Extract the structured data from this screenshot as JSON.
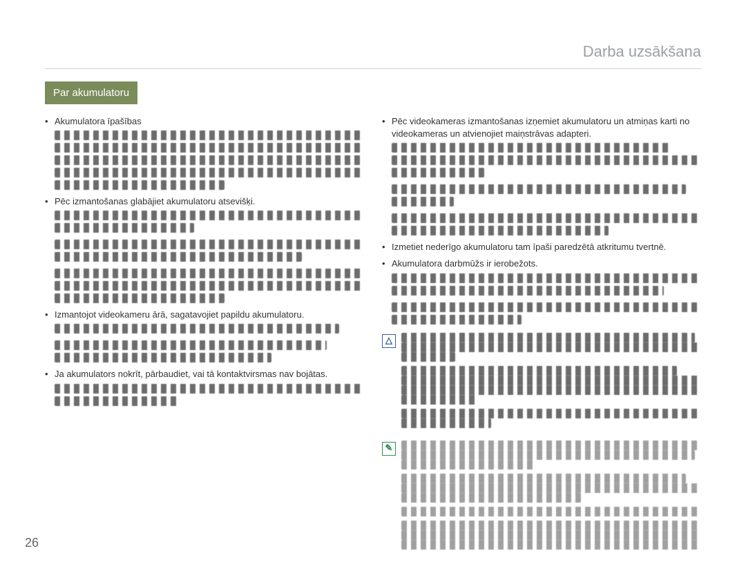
{
  "section_title": "Darba uzsākšana",
  "badge": "Par akumulatoru",
  "page_number": "26",
  "icons": {
    "warning": "warning-icon",
    "note": "note-icon"
  },
  "left": {
    "b1": "Akumulatora īpašības",
    "b2": "Pēc izmantošanas glabājiet akumulatoru atsevišķi.",
    "b3": "Izmantojot videokameru ārā, sagatavojiet papildu akumulatoru.",
    "b4": "Ja akumulators nokrīt, pārbaudiet, vai tā kontaktvirsmas nav bojātas."
  },
  "right": {
    "b1": "Pēc videokameras izmantošanas izņemiet akumulatoru un atmiņas karti no videokameras un atvienojiet maiņstrāvas adapteri.",
    "b2": "Izmetiet nederīgo akumulatoru tam īpaši paredzētā atkritumu tvertnē.",
    "b3": "Akumulatora darbmūžs ir ierobežots."
  },
  "warning_symbol": "△",
  "note_symbol": "✎"
}
